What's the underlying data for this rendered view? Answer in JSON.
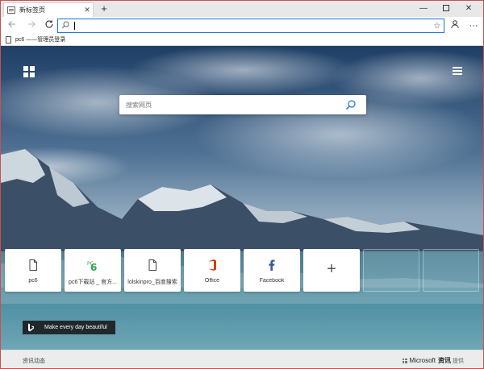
{
  "browser": {
    "tab": {
      "title": "新标签页",
      "close_glyph": "✕"
    },
    "new_tab_glyph": "+",
    "window_controls": {
      "minimize": "—",
      "close": "✕"
    }
  },
  "toolbar": {
    "address": {
      "value": "",
      "placeholder": ""
    }
  },
  "favorites": [
    {
      "label": "pc6 ——管理员登录"
    }
  ],
  "newtab": {
    "search_placeholder": "搜索网页",
    "tiles": [
      {
        "label": "pc6",
        "icon": "page-icon"
      },
      {
        "label": "pc6下载站 _ 官方...",
        "icon": "pc6-icon"
      },
      {
        "label": "lolskinpro_百度搜索",
        "icon": "page-icon"
      },
      {
        "label": "Office",
        "icon": "office-icon"
      },
      {
        "label": "Facebook",
        "icon": "facebook-icon"
      },
      {
        "label": "",
        "icon": "plus-icon",
        "glyph": "+"
      }
    ],
    "bing_caption": "Make every day beautiful"
  },
  "footer": {
    "news_link": "资讯动态",
    "brand": "Microsoft",
    "brand_news": "资讯",
    "brand_suffix": "提供"
  },
  "colors": {
    "accent": "#1a73d9",
    "window_border": "#c75050",
    "office_orange": "#d83b01",
    "facebook_blue": "#3b5998",
    "pc6_green": "#2da44e"
  }
}
